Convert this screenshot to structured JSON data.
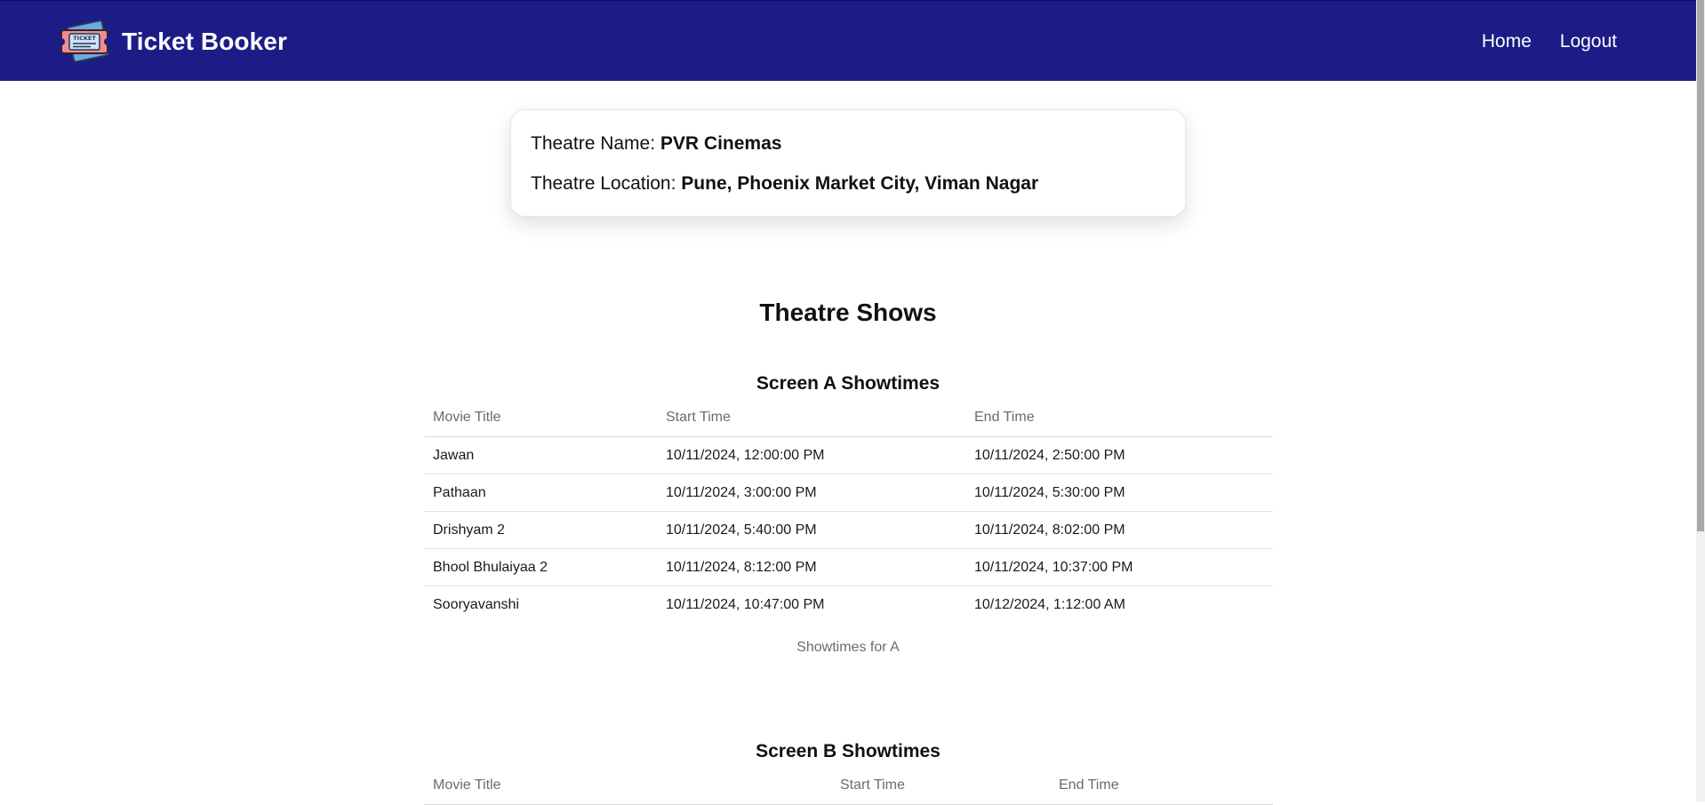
{
  "app": {
    "brand_name": "Ticket Booker",
    "logo_icon": "ticket-icon",
    "logo_text": "TICKET"
  },
  "nav": {
    "home_label": "Home",
    "logout_label": "Logout"
  },
  "theatre": {
    "name_label": "Theatre Name: ",
    "name": "PVR Cinemas",
    "location_label": "Theatre Location: ",
    "location": "Pune, Phoenix Market City, Viman Nagar"
  },
  "shows": {
    "heading": "Theatre Shows",
    "screens": [
      {
        "title": "Screen A Showtimes",
        "columns": [
          "Movie Title",
          "Start Time",
          "End Time"
        ],
        "rows": [
          [
            "Jawan",
            "10/11/2024, 12:00:00 PM",
            "10/11/2024, 2:50:00 PM"
          ],
          [
            "Pathaan",
            "10/11/2024, 3:00:00 PM",
            "10/11/2024, 5:30:00 PM"
          ],
          [
            "Drishyam 2",
            "10/11/2024, 5:40:00 PM",
            "10/11/2024, 8:02:00 PM"
          ],
          [
            "Bhool Bhulaiyaa 2",
            "10/11/2024, 8:12:00 PM",
            "10/11/2024, 10:37:00 PM"
          ],
          [
            "Sooryavanshi",
            "10/11/2024, 10:47:00 PM",
            "10/12/2024, 1:12:00 AM"
          ]
        ],
        "caption": "Showtimes for A"
      },
      {
        "title": "Screen B Showtimes",
        "columns": [
          "Movie Title",
          "Start Time",
          "End Time"
        ],
        "rows": []
      }
    ]
  },
  "colors": {
    "navbar": "#1c1c87",
    "text": "#111111",
    "muted": "#6b6b6b"
  }
}
